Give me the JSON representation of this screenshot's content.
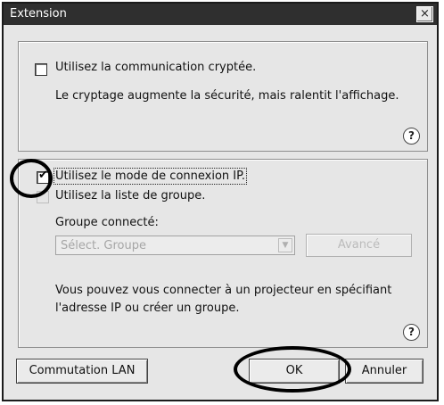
{
  "window": {
    "title": "Extension",
    "close_glyph": "×"
  },
  "encryption": {
    "checkbox_label": "Utilisez la communication cryptée.",
    "checked": false,
    "description": "Le cryptage augmente la sécurité, mais ralentit l'affichage."
  },
  "connection": {
    "ip_mode_label": "Utilisez le mode de connexion IP.",
    "ip_mode_checked": true,
    "group_list_label": "Utilisez la liste de groupe.",
    "group_list_checked": false,
    "connected_group_label": "Groupe connecté:",
    "group_select_value": "Sélect. Groupe",
    "advanced_label": "Avancé",
    "description_line1": "Vous pouvez vous connecter à un projecteur en spécifiant",
    "description_line2": "l'adresse IP ou créer un groupe."
  },
  "help_glyph": "?",
  "checkmark_glyph": "✔",
  "dropdown_glyph": "▼",
  "buttons": {
    "lan_switch": "Commutation LAN",
    "ok": "OK",
    "cancel": "Annuler"
  }
}
